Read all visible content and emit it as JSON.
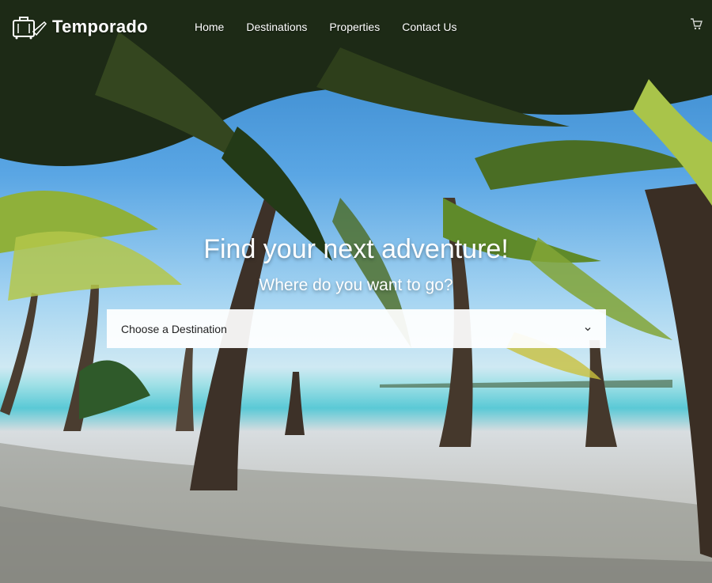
{
  "brand": {
    "name": "Temporado",
    "logo_icon": "suitcase-icon"
  },
  "nav": {
    "items": [
      {
        "label": "Home"
      },
      {
        "label": "Destinations"
      },
      {
        "label": "Properties"
      },
      {
        "label": "Contact Us"
      }
    ]
  },
  "hero": {
    "headline": "Find your next adventure!",
    "subheadline": "Where do you want to go?",
    "select": {
      "selected": "Choose a Destination",
      "icon": "chevron-down-icon"
    }
  },
  "colors": {
    "text": "#ffffff",
    "select_bg": "#ffffff",
    "select_text": "#222222"
  }
}
